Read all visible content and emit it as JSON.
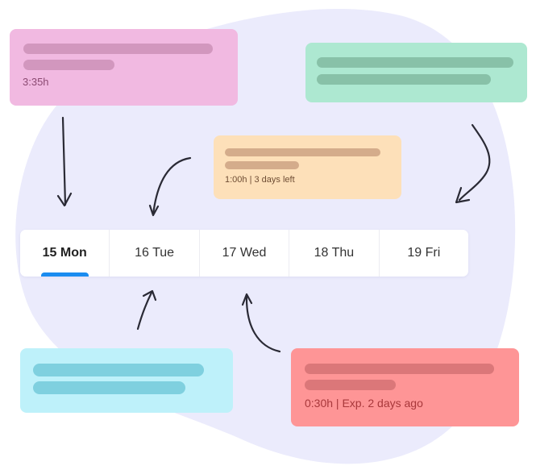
{
  "colors": {
    "blob": "#ebebfc",
    "accent": "#1a8cf0"
  },
  "cards": [
    {
      "id": "pink",
      "meta": "3:35h",
      "bg": "#f1b9e1"
    },
    {
      "id": "green",
      "meta": null,
      "bg": "#ade8d1"
    },
    {
      "id": "orange",
      "meta": "1:00h | 3 days left",
      "bg": "#fde0b9"
    },
    {
      "id": "cyan",
      "meta": null,
      "bg": "#bef1fa"
    },
    {
      "id": "red",
      "meta": "0:30h | Exp. 2 days ago",
      "bg": "#fe9596"
    }
  ],
  "tabs": {
    "items": [
      {
        "label": "15 Mon",
        "active": true
      },
      {
        "label": "16 Tue",
        "active": false
      },
      {
        "label": "17 Wed",
        "active": false
      },
      {
        "label": "18 Thu",
        "active": false
      },
      {
        "label": "19 Fri",
        "active": false
      }
    ]
  }
}
